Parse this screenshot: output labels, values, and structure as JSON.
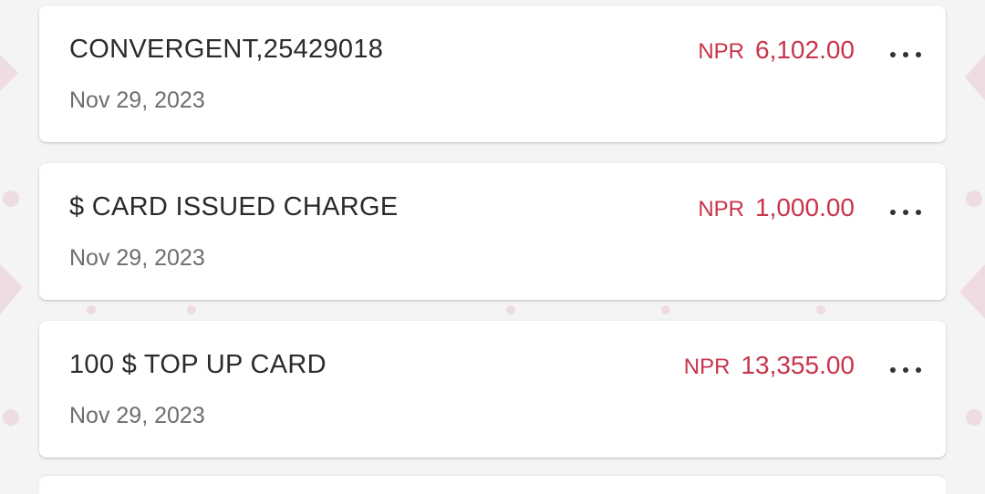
{
  "transactions": [
    {
      "title": "CONVERGENT,25429018",
      "date": "Nov 29, 2023",
      "currency": "NPR",
      "amount": "6,102.00"
    },
    {
      "title": "$ CARD ISSUED CHARGE",
      "date": "Nov 29, 2023",
      "currency": "NPR",
      "amount": "1,000.00"
    },
    {
      "title": "100 $ TOP UP CARD",
      "date": "Nov 29, 2023",
      "currency": "NPR",
      "amount": "13,355.00"
    }
  ],
  "icons": {
    "more": "more-horizontal-icon"
  },
  "colors": {
    "amount": "#c8344b",
    "background": "#f4f3f6",
    "card": "#ffffff"
  }
}
